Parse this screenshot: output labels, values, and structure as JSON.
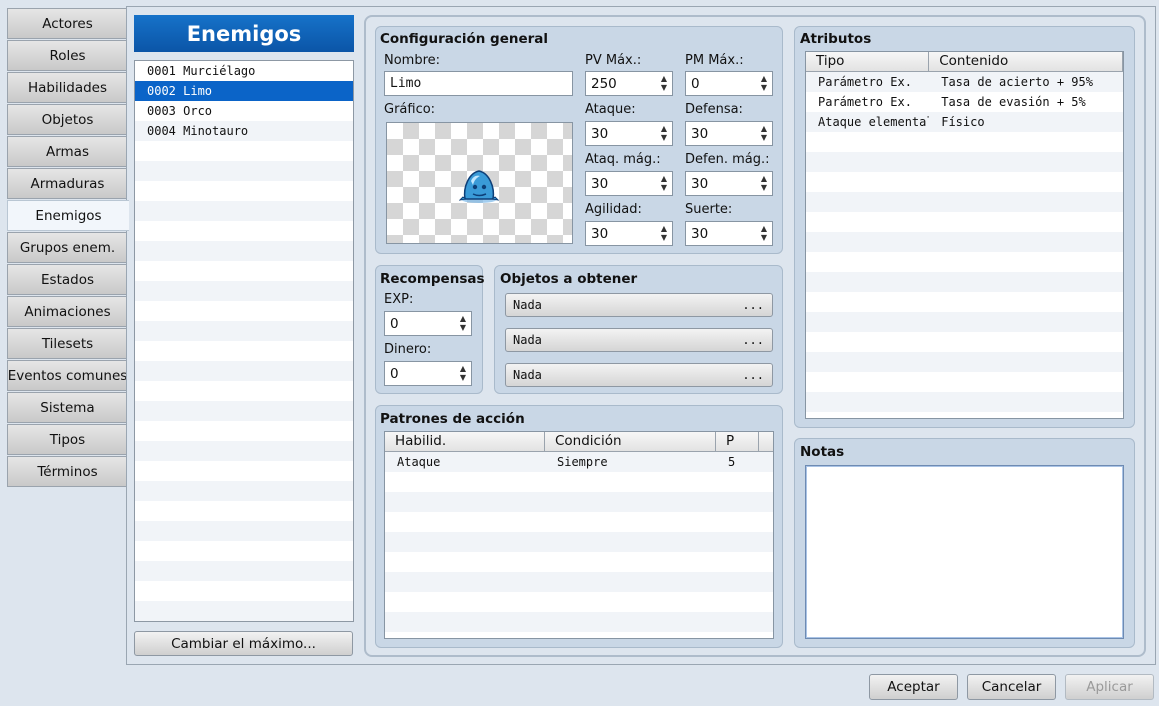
{
  "tabs": [
    "Actores",
    "Roles",
    "Habilidades",
    "Objetos",
    "Armas",
    "Armaduras",
    "Enemigos",
    "Grupos enem.",
    "Estados",
    "Animaciones",
    "Tilesets",
    "Eventos comunes",
    "Sistema",
    "Tipos",
    "Términos"
  ],
  "active_tab": "Enemigos",
  "list": {
    "title": "Enemigos",
    "items": [
      "0001 Murciélago",
      "0002 Limo",
      "0003 Orco",
      "0004 Minotauro"
    ],
    "selected": "0002 Limo",
    "change_max_label": "Cambiar el máximo..."
  },
  "general": {
    "title": "Configuración general",
    "name_label": "Nombre:",
    "name_value": "Limo",
    "graphic_label": "Gráfico:",
    "pv_max_label": "PV Máx.:",
    "pv_max": "250",
    "pm_max_label": "PM Máx.:",
    "pm_max": "0",
    "atk_label": "Ataque:",
    "atk": "30",
    "def_label": "Defensa:",
    "def": "30",
    "matk_label": "Ataq. mág.:",
    "matk": "30",
    "mdef_label": "Defen. mág.:",
    "mdef": "30",
    "agi_label": "Agilidad:",
    "agi": "30",
    "luk_label": "Suerte:",
    "luk": "30"
  },
  "rewards": {
    "title": "Recompensas",
    "exp_label": "EXP:",
    "exp": "0",
    "gold_label": "Dinero:",
    "gold": "0"
  },
  "drops": {
    "title": "Objetos a obtener",
    "items": [
      "Nada",
      "Nada",
      "Nada"
    ],
    "more": "..."
  },
  "actions": {
    "title": "Patrones de acción",
    "headers": [
      "Habilid.",
      "Condición",
      "P"
    ],
    "rows": [
      [
        "Ataque",
        "Siempre",
        "5"
      ]
    ]
  },
  "traits": {
    "title": "Atributos",
    "headers": [
      "Tipo",
      "Contenido"
    ],
    "rows": [
      [
        "Parámetro Ex.",
        "Tasa de acierto + 95%"
      ],
      [
        "Parámetro Ex.",
        "Tasa de evasión + 5%"
      ],
      [
        "Ataque elemental",
        "Físico"
      ]
    ]
  },
  "notes": {
    "title": "Notas",
    "value": ""
  },
  "footer": {
    "ok": "Aceptar",
    "cancel": "Cancelar",
    "apply": "Aplicar"
  },
  "colors": {
    "selection": "#0b64c8",
    "header_blue": "#0b55a7"
  }
}
